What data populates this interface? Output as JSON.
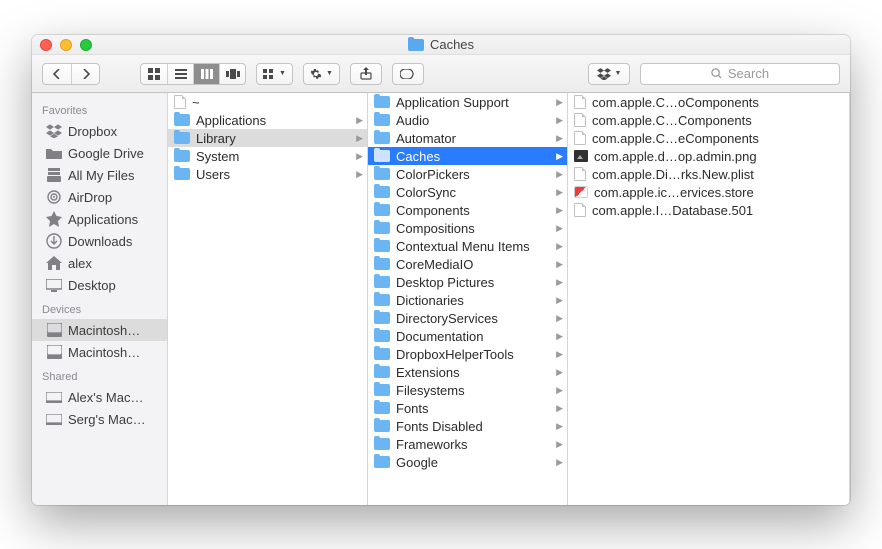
{
  "window": {
    "title": "Caches"
  },
  "toolbar": {
    "back_aria": "Back",
    "forward_aria": "Forward",
    "view_modes": [
      "icon",
      "list",
      "column",
      "cover"
    ],
    "active_view": "column",
    "search_placeholder": "Search"
  },
  "sidebar": {
    "sections": [
      {
        "header": "Favorites",
        "items": [
          {
            "icon": "dropbox",
            "label": "Dropbox"
          },
          {
            "icon": "folder-gray",
            "label": "Google Drive"
          },
          {
            "icon": "all-files",
            "label": "All My Files"
          },
          {
            "icon": "airdrop",
            "label": "AirDrop"
          },
          {
            "icon": "apps",
            "label": "Applications"
          },
          {
            "icon": "downloads",
            "label": "Downloads"
          },
          {
            "icon": "home",
            "label": "alex"
          },
          {
            "icon": "desktop",
            "label": "Desktop"
          }
        ]
      },
      {
        "header": "Devices",
        "items": [
          {
            "icon": "disk",
            "label": "Macintosh…",
            "selected": true
          },
          {
            "icon": "disk",
            "label": "Macintosh…"
          }
        ]
      },
      {
        "header": "Shared",
        "items": [
          {
            "icon": "remote",
            "label": "Alex's Mac…"
          },
          {
            "icon": "remote",
            "label": "Serg's Mac…"
          }
        ]
      }
    ]
  },
  "columns": [
    [
      {
        "icon": "blank",
        "label": "~",
        "hasChildren": false
      },
      {
        "icon": "folder",
        "label": "Applications",
        "hasChildren": true
      },
      {
        "icon": "folder",
        "label": "Library",
        "hasChildren": true,
        "selected": "weak"
      },
      {
        "icon": "folder",
        "label": "System",
        "hasChildren": true
      },
      {
        "icon": "folder",
        "label": "Users",
        "hasChildren": true
      }
    ],
    [
      {
        "icon": "folder",
        "label": "Application Support",
        "hasChildren": true
      },
      {
        "icon": "folder",
        "label": "Audio",
        "hasChildren": true
      },
      {
        "icon": "folder",
        "label": "Automator",
        "hasChildren": true
      },
      {
        "icon": "folder",
        "label": "Caches",
        "hasChildren": true,
        "selected": "strong"
      },
      {
        "icon": "folder",
        "label": "ColorPickers",
        "hasChildren": true
      },
      {
        "icon": "folder",
        "label": "ColorSync",
        "hasChildren": true
      },
      {
        "icon": "folder",
        "label": "Components",
        "hasChildren": true
      },
      {
        "icon": "folder",
        "label": "Compositions",
        "hasChildren": true
      },
      {
        "icon": "folder",
        "label": "Contextual Menu Items",
        "hasChildren": true
      },
      {
        "icon": "folder",
        "label": "CoreMediaIO",
        "hasChildren": true
      },
      {
        "icon": "folder",
        "label": "Desktop Pictures",
        "hasChildren": true
      },
      {
        "icon": "folder",
        "label": "Dictionaries",
        "hasChildren": true
      },
      {
        "icon": "folder",
        "label": "DirectoryServices",
        "hasChildren": true
      },
      {
        "icon": "folder",
        "label": "Documentation",
        "hasChildren": true
      },
      {
        "icon": "folder",
        "label": "DropboxHelperTools",
        "hasChildren": true
      },
      {
        "icon": "folder",
        "label": "Extensions",
        "hasChildren": true
      },
      {
        "icon": "folder",
        "label": "Filesystems",
        "hasChildren": true
      },
      {
        "icon": "folder",
        "label": "Fonts",
        "hasChildren": true
      },
      {
        "icon": "folder",
        "label": "Fonts Disabled",
        "hasChildren": true
      },
      {
        "icon": "folder",
        "label": "Frameworks",
        "hasChildren": true
      },
      {
        "icon": "folder",
        "label": "Google",
        "hasChildren": true
      }
    ],
    [
      {
        "icon": "blank",
        "label": "com.apple.C…oComponents"
      },
      {
        "icon": "blank",
        "label": "com.apple.C…Components"
      },
      {
        "icon": "blank",
        "label": "com.apple.C…eComponents"
      },
      {
        "icon": "png",
        "label": "com.apple.d…op.admin.png"
      },
      {
        "icon": "blank",
        "label": "com.apple.Di…rks.New.plist"
      },
      {
        "icon": "store",
        "label": "com.apple.ic…ervices.store"
      },
      {
        "icon": "blank",
        "label": "com.apple.I…Database.501"
      }
    ]
  ]
}
